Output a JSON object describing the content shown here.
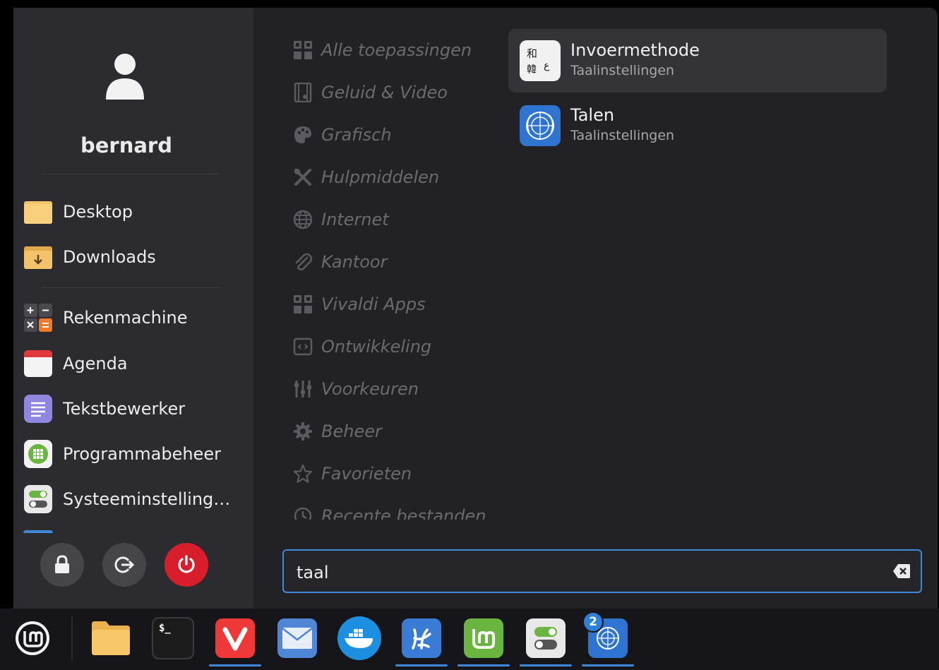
{
  "user": {
    "name": "bernard"
  },
  "places": [
    {
      "label": "Desktop",
      "icon": "folder-icon"
    },
    {
      "label": "Downloads",
      "icon": "downloads-folder-icon"
    }
  ],
  "favorites": [
    {
      "label": "Rekenmachine",
      "icon": "calculator-icon"
    },
    {
      "label": "Agenda",
      "icon": "calendar-icon"
    },
    {
      "label": "Tekstbewerker",
      "icon": "text-editor-icon"
    },
    {
      "label": "Programmabeheer",
      "icon": "software-manager-icon"
    },
    {
      "label": "Systeeminstelling…",
      "icon": "system-settings-icon"
    }
  ],
  "system_buttons": [
    {
      "name": "lock",
      "icon": "lock-icon"
    },
    {
      "name": "logout",
      "icon": "logout-icon"
    },
    {
      "name": "shutdown",
      "icon": "power-icon",
      "color": "#d81e2c"
    }
  ],
  "categories": [
    {
      "label": "Alle toepassingen",
      "icon": "grid-icon"
    },
    {
      "label": "Geluid & Video",
      "icon": "film-icon"
    },
    {
      "label": "Grafisch",
      "icon": "palette-icon"
    },
    {
      "label": "Hulpmiddelen",
      "icon": "tools-icon"
    },
    {
      "label": "Internet",
      "icon": "globe-icon"
    },
    {
      "label": "Kantoor",
      "icon": "paperclip-icon"
    },
    {
      "label": "Vivaldi Apps",
      "icon": "grid-icon"
    },
    {
      "label": "Ontwikkeling",
      "icon": "code-icon"
    },
    {
      "label": "Voorkeuren",
      "icon": "sliders-icon"
    },
    {
      "label": "Beheer",
      "icon": "gear-icon"
    },
    {
      "label": "Favorieten",
      "icon": "star-icon"
    },
    {
      "label": "Recente bestanden",
      "icon": "history-icon"
    }
  ],
  "results": [
    {
      "name": "Invoermethode",
      "description": "Taalinstellingen",
      "icon": "input-method-icon",
      "selected": true
    },
    {
      "name": "Talen",
      "description": "Taalinstellingen",
      "icon": "un-globe-icon",
      "selected": false
    }
  ],
  "search": {
    "value": "taal"
  },
  "taskbar": {
    "items": [
      {
        "name": "mint-menu",
        "icon": "linux-mint-logo-icon"
      },
      {
        "name": "files",
        "icon": "folder-icon"
      },
      {
        "name": "terminal",
        "icon": "terminal-icon",
        "glyph": "$_"
      },
      {
        "name": "vivaldi",
        "icon": "vivaldi-icon",
        "active": true
      },
      {
        "name": "mail",
        "icon": "mail-icon"
      },
      {
        "name": "docker",
        "icon": "docker-icon"
      },
      {
        "name": "vscodium",
        "icon": "vscodium-icon",
        "active": true
      },
      {
        "name": "mintinstall",
        "icon": "mint-software-icon",
        "active": true
      },
      {
        "name": "settings",
        "icon": "settings-toggle-icon",
        "active": true
      },
      {
        "name": "languages",
        "icon": "un-globe-icon",
        "active": true,
        "badge": "2"
      }
    ]
  },
  "colors": {
    "accent": "#3f8ad8",
    "power": "#d81e2c",
    "vivaldi": "#ef3939",
    "mint": "#69b53f"
  }
}
